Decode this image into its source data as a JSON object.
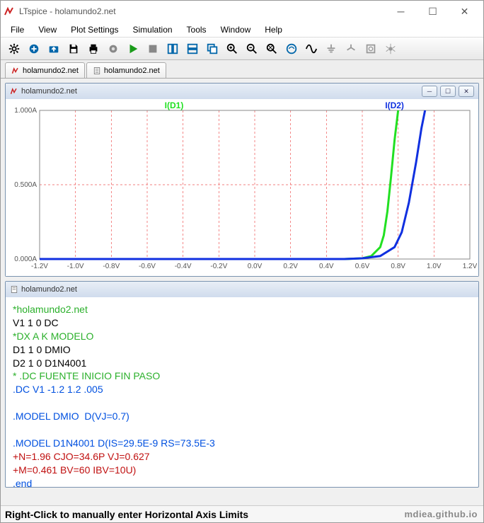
{
  "window": {
    "title": "LTspice - holamundo2.net"
  },
  "menu": {
    "items": [
      "File",
      "View",
      "Plot Settings",
      "Simulation",
      "Tools",
      "Window",
      "Help"
    ]
  },
  "tabs": [
    {
      "label": "holamundo2.net",
      "icon": "waveform-icon"
    },
    {
      "label": "holamundo2.net",
      "icon": "doc-icon"
    }
  ],
  "plot_panel": {
    "title": "holamundo2.net",
    "traces": [
      "I(D1)",
      "I(D2)"
    ],
    "y_ticks": [
      "1.000A",
      "0.500A",
      "0.000A"
    ],
    "x_ticks": [
      "-1.2V",
      "-1.0V",
      "-0.8V",
      "-0.6V",
      "-0.4V",
      "-0.2V",
      "0.0V",
      "0.2V",
      "0.4V",
      "0.6V",
      "0.8V",
      "1.0V",
      "1.2V"
    ]
  },
  "net_panel": {
    "title": "holamundo2.net",
    "lines": [
      {
        "text": "*holamundo2.net",
        "cls": "c-cmt"
      },
      {
        "text": "V1 1 0 DC",
        "cls": "c-txt"
      },
      {
        "text": "*DX A K MODELO",
        "cls": "c-cmt"
      },
      {
        "text": "D1 1 0 DMIO",
        "cls": "c-txt"
      },
      {
        "text": "D2 1 0 D1N4001",
        "cls": "c-txt"
      },
      {
        "text": "* .DC FUENTE INICIO FIN PASO",
        "cls": "c-cmt"
      },
      {
        "text": ".DC V1 -1.2 1.2 .005",
        "cls": "c-dir"
      },
      {
        "text": "",
        "cls": "c-txt"
      },
      {
        "text": ".MODEL DMIO  D(VJ=0.7)",
        "cls": "c-dir"
      },
      {
        "text": "",
        "cls": "c-txt"
      },
      {
        "text": ".MODEL D1N4001 D(IS=29.5E-9 RS=73.5E-3",
        "cls": "c-dir"
      },
      {
        "text": "+N=1.96 CJO=34.6P VJ=0.627",
        "cls": "c-cont"
      },
      {
        "text": "+M=0.461 BV=60 IBV=10U)",
        "cls": "c-cont"
      },
      {
        "text": ".end",
        "cls": "c-dir"
      }
    ]
  },
  "status": {
    "hint": "Right-Click to manually enter Horizontal Axis Limits",
    "watermark": "mdiea.github.io"
  },
  "chart_data": {
    "type": "line",
    "title": "",
    "xlabel": "V",
    "ylabel": "A",
    "xlim": [
      -1.2,
      1.2
    ],
    "ylim": [
      0.0,
      1.0
    ],
    "x_ticks": [
      -1.2,
      -1.0,
      -0.8,
      -0.6,
      -0.4,
      -0.2,
      0.0,
      0.2,
      0.4,
      0.6,
      0.8,
      1.0,
      1.2
    ],
    "y_ticks": [
      0.0,
      0.5,
      1.0
    ],
    "series": [
      {
        "name": "I(D1)",
        "color": "#22e022",
        "x": [
          -1.2,
          0.0,
          0.5,
          0.6,
          0.65,
          0.7,
          0.72,
          0.74,
          0.76,
          0.78,
          0.8
        ],
        "y": [
          0.0,
          0.0,
          0.0,
          0.005,
          0.02,
          0.08,
          0.16,
          0.32,
          0.55,
          0.8,
          1.0
        ]
      },
      {
        "name": "I(D2)",
        "color": "#1030e0",
        "x": [
          -1.2,
          0.0,
          0.5,
          0.6,
          0.7,
          0.78,
          0.82,
          0.86,
          0.9,
          0.93,
          0.95
        ],
        "y": [
          0.0,
          0.0,
          0.0,
          0.005,
          0.02,
          0.08,
          0.18,
          0.38,
          0.65,
          0.88,
          1.0
        ]
      }
    ]
  }
}
